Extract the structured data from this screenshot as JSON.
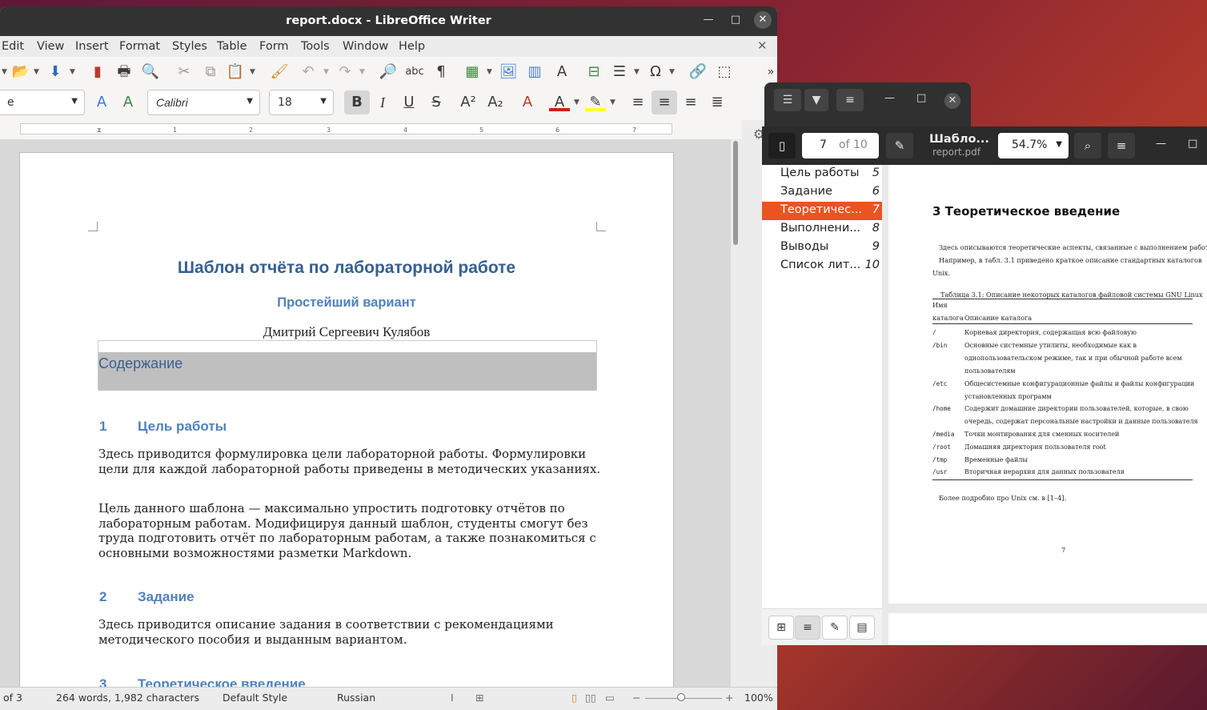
{
  "writer": {
    "title": "report.docx - LibreOffice Writer",
    "menu": [
      "Edit",
      "View",
      "Insert",
      "Format",
      "Styles",
      "Table",
      "Form",
      "Tools",
      "Window",
      "Help"
    ],
    "para_style": "e",
    "font_name": "Calibri",
    "font_size": "18",
    "ruler_ticks": [
      "1",
      "2",
      "3",
      "4",
      "5",
      "6",
      "7"
    ],
    "doc": {
      "title": "Шаблон отчёта по лабораторной работе",
      "subtitle": "Простейший вариант",
      "author": "Дмитрий Сергеевич Кулябов",
      "toc_heading": "Содержание",
      "sections": [
        {
          "num": "1",
          "title": "Цель работы"
        },
        {
          "num": "2",
          "title": "Задание"
        },
        {
          "num": "3",
          "title": "Теоретическое введение"
        }
      ],
      "p1": "Здесь приводится формулировка цели лабораторной работы. Формулировки цели для каждой лабораторной работы приведены в методических указаниях.",
      "p2": "Цель данного шаблона — максимально упростить подготовку отчётов по лабораторным работам. Модифицируя данный шаблон, студенты смогут без труда подготовить отчёт по лабораторным работам, а также познакомиться с основными возможностями разметки Markdown.",
      "p3": "Здесь приводится описание задания в соответствии с рекомендациями методического пособия и выданным вариантом."
    },
    "status": {
      "page": "of 3",
      "words": "264 words, 1,982 characters",
      "style": "Default Style",
      "language": "Russian",
      "zoom": "100%"
    }
  },
  "viewer": {
    "page_current": "7",
    "page_total": "of 10",
    "title": "Шабло...",
    "filename": "report.pdf",
    "zoom": "54.7%",
    "outline": [
      {
        "label": "Цель работы",
        "page": "5",
        "selected": false
      },
      {
        "label": "Задание",
        "page": "6",
        "selected": false
      },
      {
        "label": "Теоретичес...",
        "page": "7",
        "selected": true
      },
      {
        "label": "Выполнени...",
        "page": "8",
        "selected": false
      },
      {
        "label": "Выводы",
        "page": "9",
        "selected": false
      },
      {
        "label": "Список лит...",
        "page": "10",
        "selected": false
      }
    ],
    "pdf": {
      "heading": "3  Теоретическое введение",
      "intro1": "Здесь описываются теоретические аспекты, связанные с выполнением работы.",
      "intro2": "Например, в табл. 3.1 приведено краткое описание стандартных каталогов",
      "intro3": "Unix.",
      "caption": "Таблица 3.1: Описание некоторых каталогов файловой системы GNU Linux",
      "col1a": "Имя",
      "col1b": "каталога",
      "col2": "Описание каталога",
      "rows": [
        {
          "name": "/",
          "lines": [
            "Корневая директория, содержащая всю файловую"
          ]
        },
        {
          "name": "/bin",
          "lines": [
            "Основные системные утилиты, необходимые как в",
            "однопользовательском режиме, так и при обычной работе всем",
            "пользователям"
          ]
        },
        {
          "name": "/etc",
          "lines": [
            "Общесистемные конфигурационные файлы и файлы конфигурации",
            "установленных программ"
          ]
        },
        {
          "name": "/home",
          "lines": [
            "Содержит домашние директории пользователей, которые, в свою",
            "очередь, содержат персональные настройки и данные пользователя"
          ]
        },
        {
          "name": "/media",
          "lines": [
            "Точки монтирования для сменных носителей"
          ]
        },
        {
          "name": "/root",
          "lines": [
            "Домашняя директория пользователя root"
          ]
        },
        {
          "name": "/tmp",
          "lines": [
            "Временные файлы"
          ]
        },
        {
          "name": "/usr",
          "lines": [
            "Вторичная иерархия для данных пользователя"
          ]
        }
      ],
      "footer_text": "Более подробно про Unix см. в [1–4].",
      "page_no": "7"
    }
  }
}
